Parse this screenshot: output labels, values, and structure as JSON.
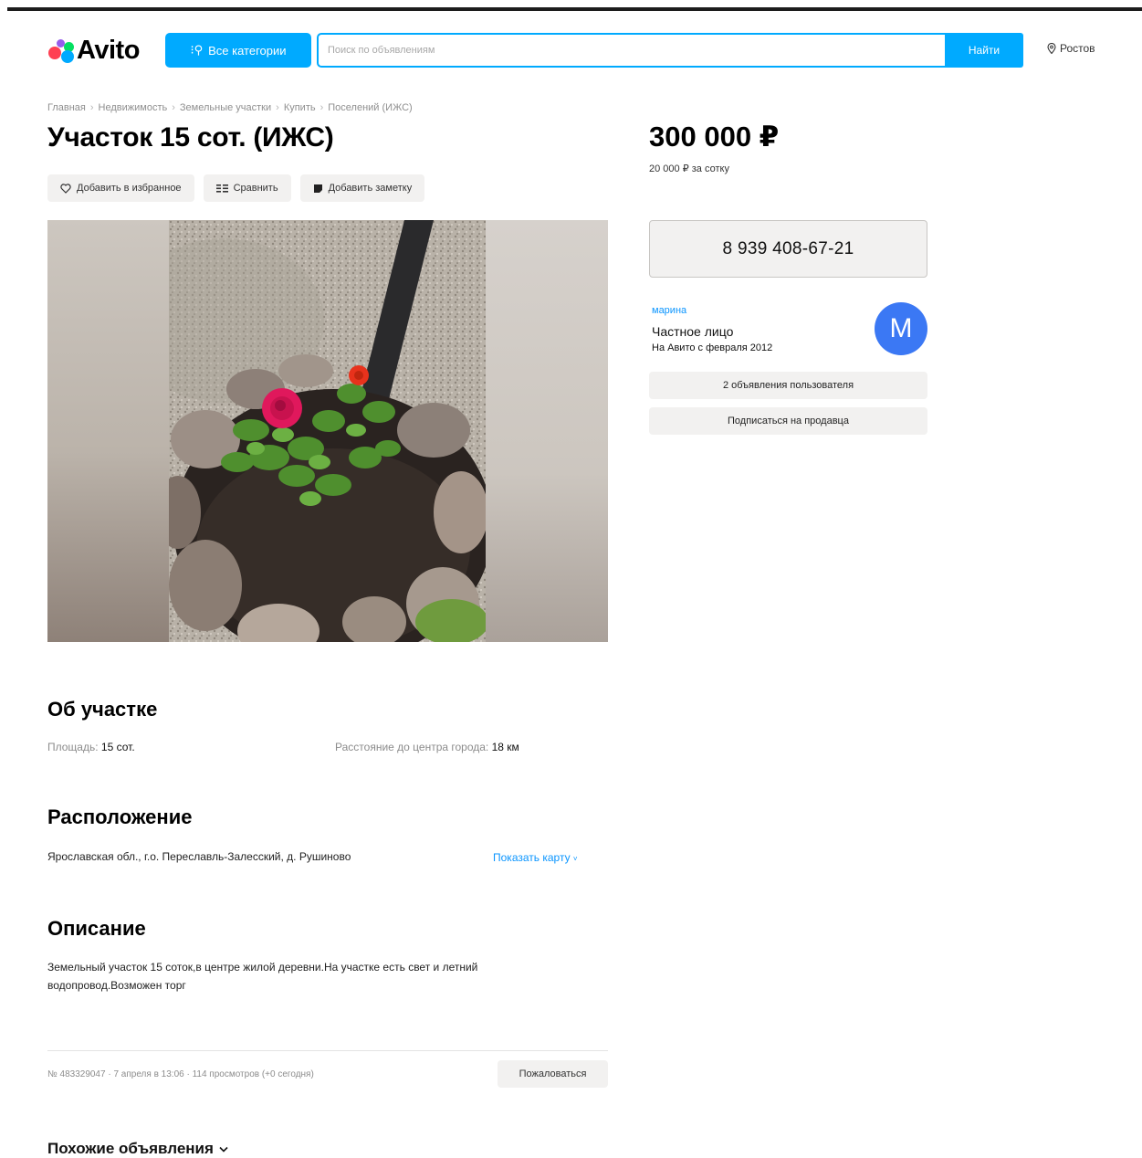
{
  "header": {
    "logo_text": "Avito",
    "categories_label": "Все категории",
    "search_placeholder": "Поиск по объявлениям",
    "find_label": "Найти",
    "city": "Ростов",
    "accent_color": "#00aaff"
  },
  "breadcrumbs": [
    "Главная",
    "Недвижимость",
    "Земельные участки",
    "Купить",
    "Поселений (ИЖС)"
  ],
  "listing": {
    "title": "Участок 15 сот. (ИЖС)",
    "actions": {
      "favorite": "Добавить в избранное",
      "compare": "Сравнить",
      "note": "Добавить заметку"
    },
    "price": "300 000 ₽",
    "price_per_unit": "20 000 ₽ за сотку",
    "phone": "8 939 408-67-21"
  },
  "seller": {
    "name": "марина",
    "type": "Частное лицо",
    "since": "На Авито с февраля 2012",
    "avatar_letter": "М",
    "listings_button": "2 объявления пользователя",
    "subscribe_button": "Подписаться на продавца"
  },
  "about": {
    "heading": "Об участке",
    "area_label": "Площадь:",
    "area_value": "15 сот.",
    "distance_label": "Расстояние до центра города:",
    "distance_value": "18 км"
  },
  "location": {
    "heading": "Расположение",
    "address": "Ярославская обл., г.о. Переславль-Залесский, д. Рушиново",
    "show_map": "Показать карту"
  },
  "description": {
    "heading": "Описание",
    "text": "Земельный участок 15 соток,в центре жилой деревни.На участке есть свет и летний водопровод.Возможен торг"
  },
  "footer": {
    "meta": "№ 483329047 · 7 апреля в 13:06 · 114 просмотров (+0 сегодня)",
    "complain": "Пожаловаться",
    "similar": "Похожие объявления"
  }
}
